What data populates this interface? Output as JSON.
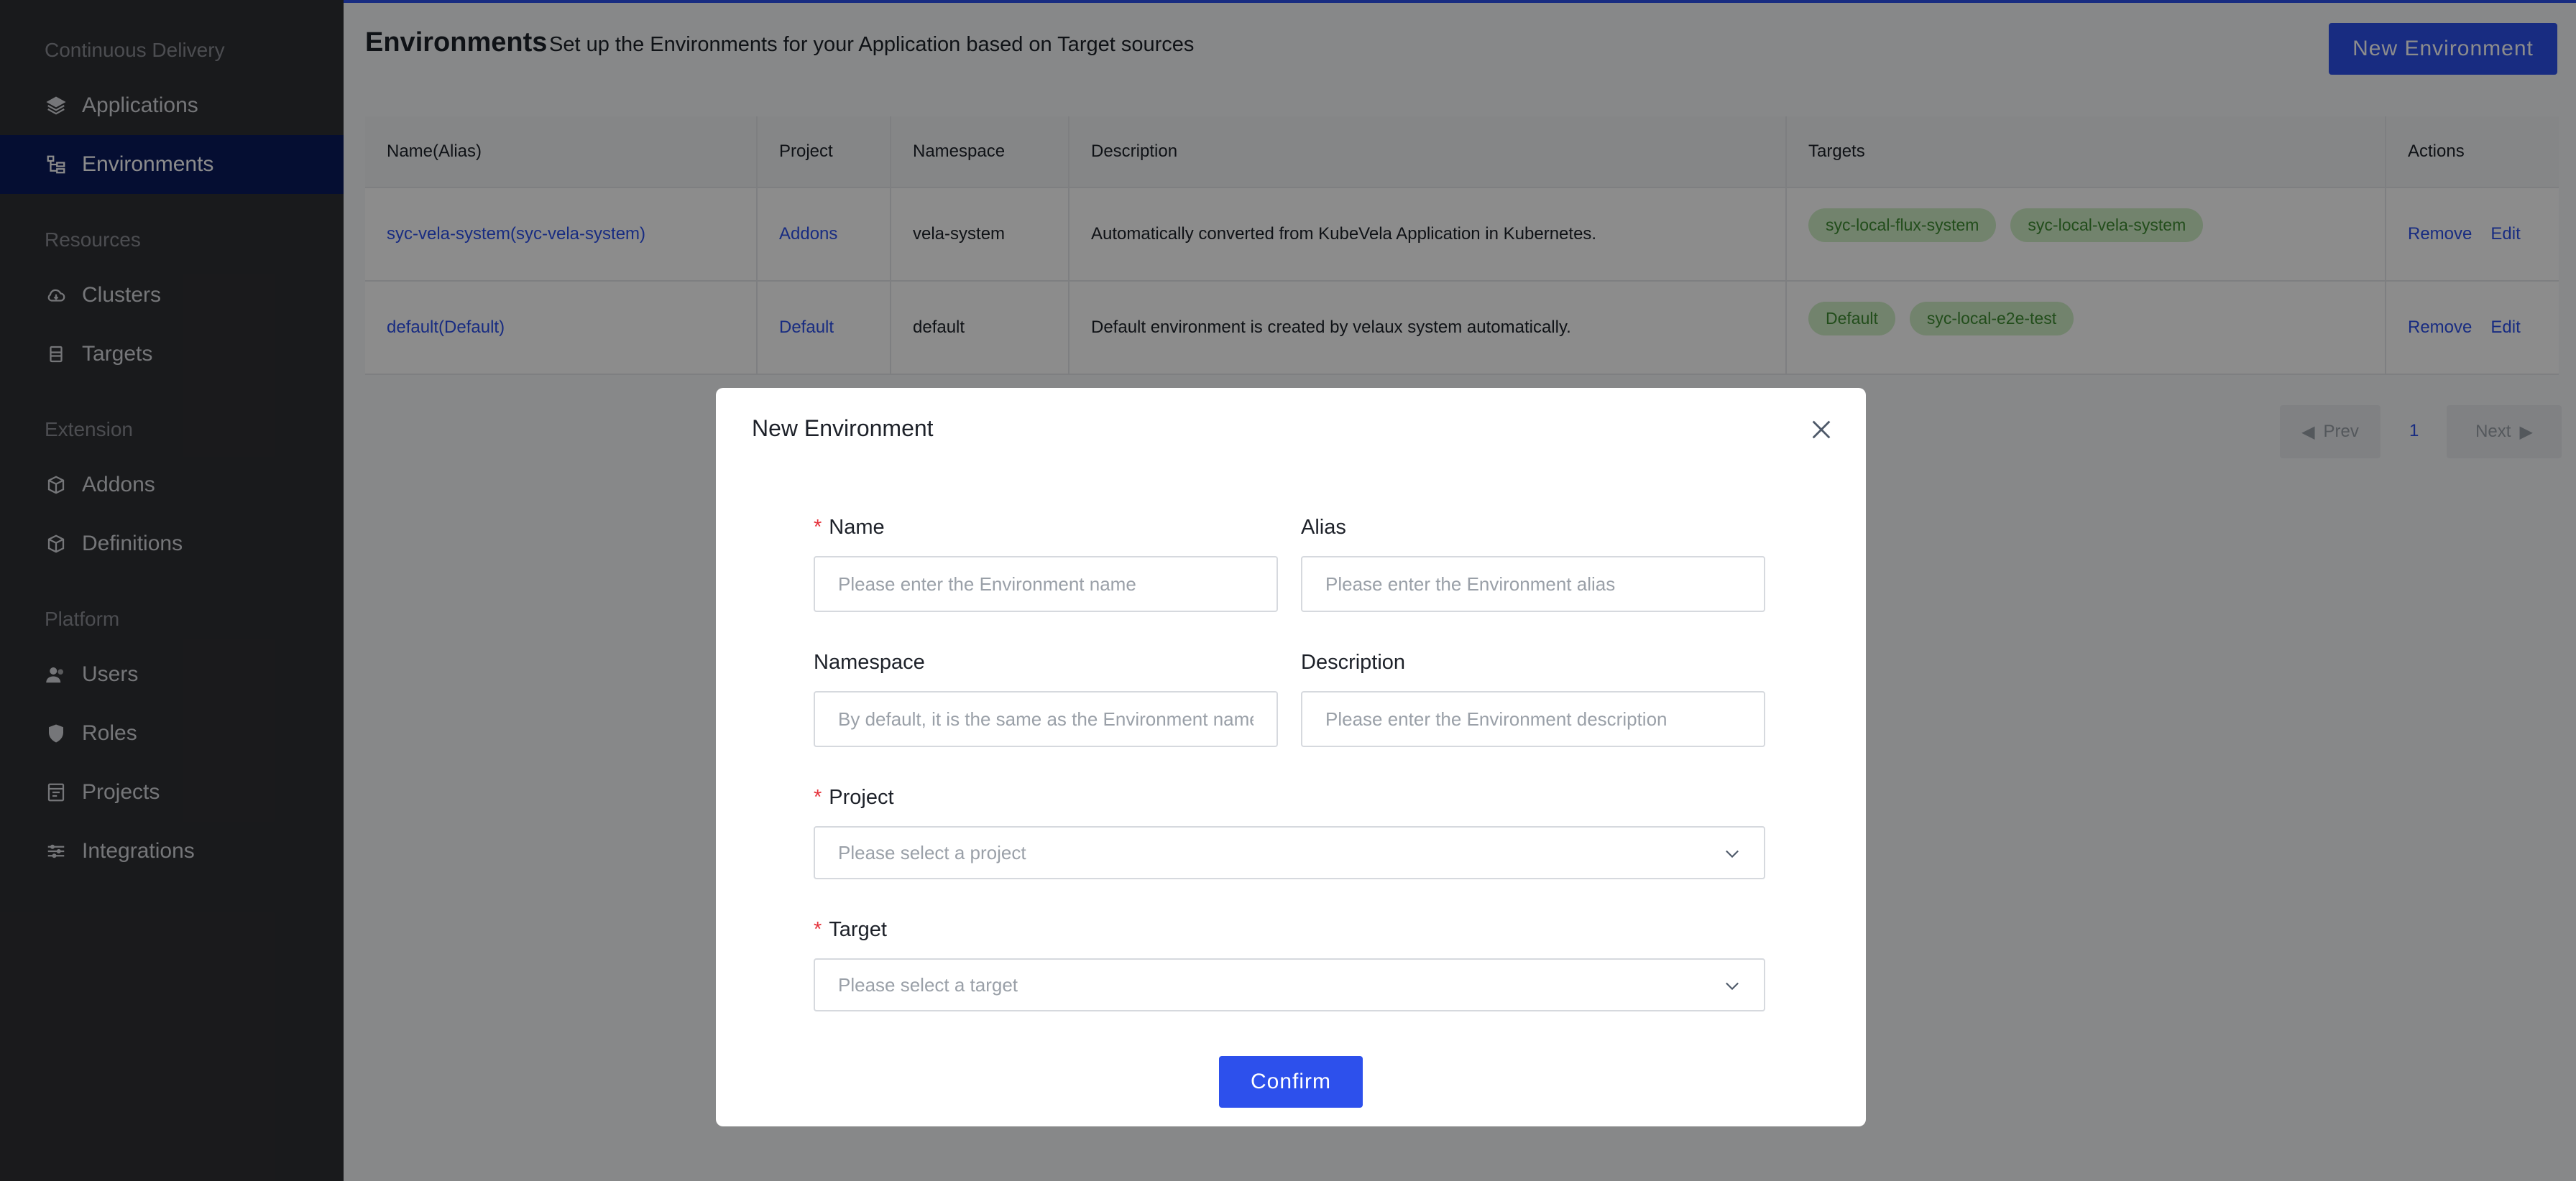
{
  "sidebar": {
    "groups": [
      {
        "label": "Continuous Delivery"
      },
      {
        "label": "Resources"
      },
      {
        "label": "Extension"
      },
      {
        "label": "Platform"
      }
    ],
    "items": [
      {
        "label": "Applications",
        "icon": "layers-icon"
      },
      {
        "label": "Environments",
        "icon": "environments-icon",
        "active": true
      },
      {
        "label": "Clusters",
        "icon": "cloud-icon"
      },
      {
        "label": "Targets",
        "icon": "target-icon"
      },
      {
        "label": "Addons",
        "icon": "package-icon"
      },
      {
        "label": "Definitions",
        "icon": "package-icon"
      },
      {
        "label": "Users",
        "icon": "users-icon"
      },
      {
        "label": "Roles",
        "icon": "shield-icon"
      },
      {
        "label": "Projects",
        "icon": "project-icon"
      },
      {
        "label": "Integrations",
        "icon": "integrations-icon"
      }
    ]
  },
  "header": {
    "title": "Environments",
    "subtitle": "Set up the Environments for your Application based on Target sources",
    "new_button": "New Environment"
  },
  "table": {
    "columns": [
      "Name(Alias)",
      "Project",
      "Namespace",
      "Description",
      "Targets",
      "Actions"
    ],
    "rows": [
      {
        "name": "syc-vela-system(syc-vela-system)",
        "project": "Addons",
        "namespace": "vela-system",
        "description": "Automatically converted from KubeVela Application in Kubernetes.",
        "targets": [
          "syc-local-flux-system",
          "syc-local-vela-system"
        ],
        "remove": "Remove",
        "edit": "Edit"
      },
      {
        "name": "default(Default)",
        "project": "Default",
        "namespace": "default",
        "description": "Default environment is created by velaux system automatically.",
        "targets": [
          "Default",
          "syc-local-e2e-test"
        ],
        "remove": "Remove",
        "edit": "Edit"
      }
    ]
  },
  "pagination": {
    "prev": "Prev",
    "page": "1",
    "next": "Next"
  },
  "modal": {
    "title": "New Environment",
    "name_label": "Name",
    "name_placeholder": "Please enter the Environment name",
    "alias_label": "Alias",
    "alias_placeholder": "Please enter the Environment alias",
    "namespace_label": "Namespace",
    "namespace_placeholder": "By default, it is the same as the Environment name",
    "description_label": "Description",
    "description_placeholder": "Please enter the Environment description",
    "project_label": "Project",
    "project_placeholder": "Please select a project",
    "target_label": "Target",
    "target_placeholder": "Please select a target",
    "confirm": "Confirm",
    "required_mark": "*"
  },
  "colors": {
    "accent": "#2d50ec",
    "sidebar_bg": "#2f3033",
    "sidebar_active": "#0a1a5c",
    "tag_bg": "#cfeec6",
    "tag_text": "#3e8c32",
    "required": "#e5323b"
  }
}
